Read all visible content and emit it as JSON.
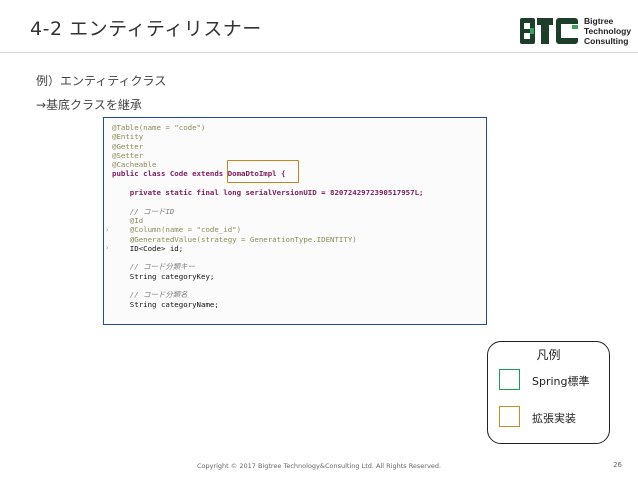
{
  "slide": {
    "title": "4-2 エンティティリスナー",
    "subtitle_1": "例）エンティティクラス",
    "subtitle_2": "→基底クラスを継承",
    "footer": "Copyright © 2017 Bigtree Technology&Consulting Ltd. All Rights Reserved.",
    "page_number": "26"
  },
  "logo": {
    "mark_text": "BTC",
    "name_line1": "Bigtree",
    "name_line2": "Technology",
    "name_line3": "Consulting"
  },
  "code": {
    "lines": [
      "@Table(name = \"code\")",
      "@Entity",
      "@Getter",
      "@Setter",
      "@Cacheable",
      "public class Code extends DomaDtoImpl {",
      "",
      "    private static final long serialVersionUID = 8207242972390517957L;",
      "",
      "    // コードID",
      "    @Id",
      "    @Column(name = \"code_id\")",
      "    @GeneratedValue(strategy = GenerationType.IDENTITY)",
      "    ID<Code> id;",
      "",
      "    // コード分類キー",
      "    String categoryKey;",
      "",
      "    // コード分類名",
      "    String categoryName;"
    ]
  },
  "legend": {
    "title": "凡例",
    "items": [
      {
        "label": "Spring標準",
        "color": "#1f9a52"
      },
      {
        "label": "拡張実装",
        "color": "#c98b2a"
      }
    ]
  },
  "colors": {
    "code_frame_border": "#1f4aa8",
    "highlight_box": "#c2861f"
  }
}
